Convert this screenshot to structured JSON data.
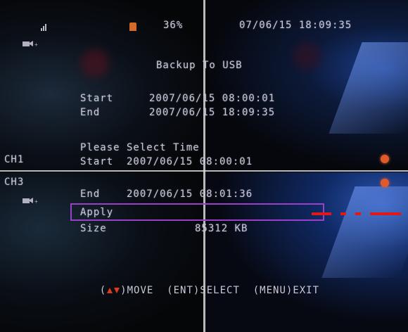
{
  "status_bar": {
    "signal_icon": "signal-bars-icon",
    "storage_icon": "hdd-icon",
    "percent": "36%",
    "datetime": "07/06/15 18:09:35"
  },
  "channels": {
    "ch1": "CH1",
    "ch3": "CH3",
    "record_icon": "camera-record-icon"
  },
  "backup_dialog": {
    "title": "Backup To USB",
    "start_label": "Start",
    "start_value": "2007/06/15 08:00:01",
    "end_label": "End",
    "end_value": "2007/06/15 18:09:35",
    "prompt": "Please Select Time",
    "sel_start_label": "Start",
    "sel_start_value": "2007/06/15 08:00:01",
    "sel_end_label": "End",
    "sel_end_value": "2007/06/15 08:01:36",
    "apply_label": "Apply",
    "size_label": "Size",
    "size_value": "85312 KB"
  },
  "hint_bar": {
    "open_paren": "(",
    "move": ")MOVE",
    "select": "(ENT)SELECT",
    "exit": "(MENU)EXIT"
  },
  "colors": {
    "osd_text": "#c9c9d8",
    "highlight_border": "#9b3fc8",
    "alert_dot": "#e05a2a",
    "arrow": "#e03a1a"
  }
}
